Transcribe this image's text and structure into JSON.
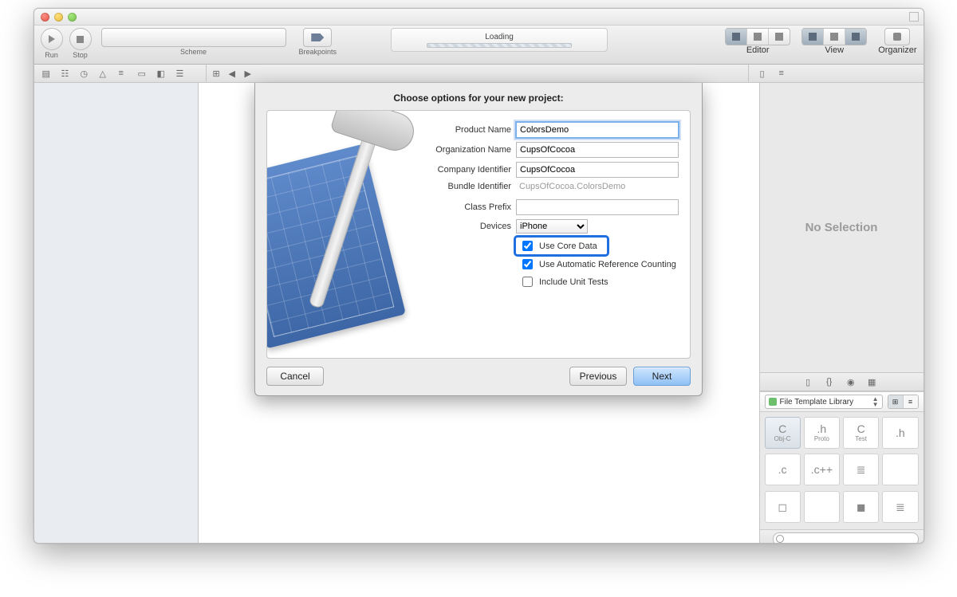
{
  "toolbar": {
    "run_label": "Run",
    "stop_label": "Stop",
    "scheme_label": "Scheme",
    "breakpoints_label": "Breakpoints",
    "editor_label": "Editor",
    "view_label": "View",
    "organizer_label": "Organizer",
    "loading_label": "Loading"
  },
  "inspector": {
    "no_selection": "No Selection",
    "library_select": "File Template Library",
    "library_items": [
      {
        "label": "Obj-C",
        "glyph": "C"
      },
      {
        "label": "Proto",
        "glyph": ".h"
      },
      {
        "label": "Test",
        "glyph": "C"
      },
      {
        "label": "",
        "glyph": ".h"
      },
      {
        "label": "",
        "glyph": ".c"
      },
      {
        "label": "",
        "glyph": ".c++"
      },
      {
        "label": "",
        "glyph": "≣"
      },
      {
        "label": "",
        "glyph": " "
      },
      {
        "label": "",
        "glyph": "◻"
      },
      {
        "label": "",
        "glyph": " "
      },
      {
        "label": "",
        "glyph": "◼"
      },
      {
        "label": "",
        "glyph": "≣"
      }
    ]
  },
  "sheet": {
    "title": "Choose options for your new project:",
    "labels": {
      "product_name": "Product Name",
      "organization_name": "Organization Name",
      "company_identifier": "Company Identifier",
      "bundle_identifier": "Bundle Identifier",
      "class_prefix": "Class Prefix",
      "devices": "Devices"
    },
    "values": {
      "product_name": "ColorsDemo",
      "organization_name": "CupsOfCocoa",
      "company_identifier": "CupsOfCocoa",
      "bundle_identifier": "CupsOfCocoa.ColorsDemo",
      "class_prefix": "",
      "devices": "iPhone"
    },
    "checkboxes": {
      "use_core_data": "Use Core Data",
      "use_arc": "Use Automatic Reference Counting",
      "include_unit_tests": "Include Unit Tests"
    },
    "checkbox_state": {
      "use_core_data": true,
      "use_arc": true,
      "include_unit_tests": false
    },
    "buttons": {
      "cancel": "Cancel",
      "previous": "Previous",
      "next": "Next"
    }
  }
}
